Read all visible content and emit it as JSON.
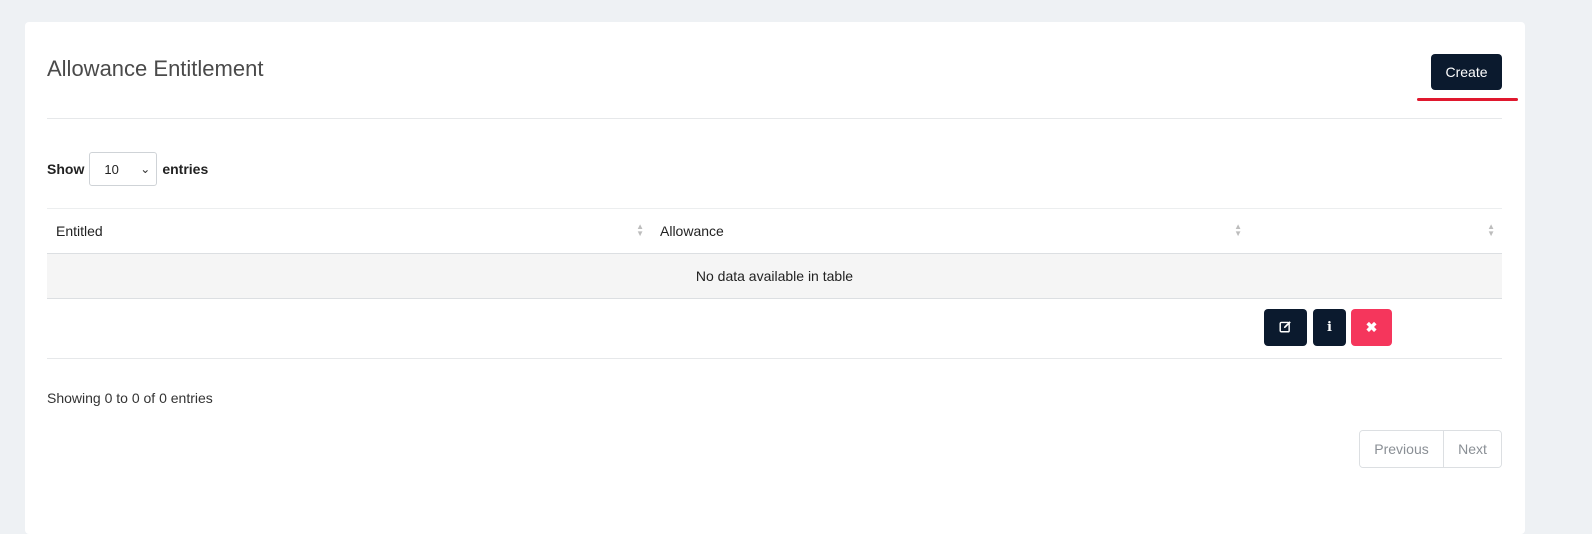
{
  "page": {
    "title": "Allowance Entitlement",
    "create_label": "Create"
  },
  "length_menu": {
    "show_label": "Show",
    "selected_value": "10",
    "entries_label": "entries"
  },
  "table": {
    "columns": [
      "Entitled",
      "Allowance",
      ""
    ],
    "empty_message": "No data available in table"
  },
  "actions": {
    "edit_icon": "edit-icon",
    "info_icon": "info-icon",
    "delete_icon": "close-icon"
  },
  "footer": {
    "info": "Showing 0 to 0 of 0 entries",
    "previous_label": "Previous",
    "next_label": "Next"
  },
  "colors": {
    "primary_dark": "#0b1a2e",
    "danger": "#f5365c",
    "annotation_red": "#e0182e"
  }
}
